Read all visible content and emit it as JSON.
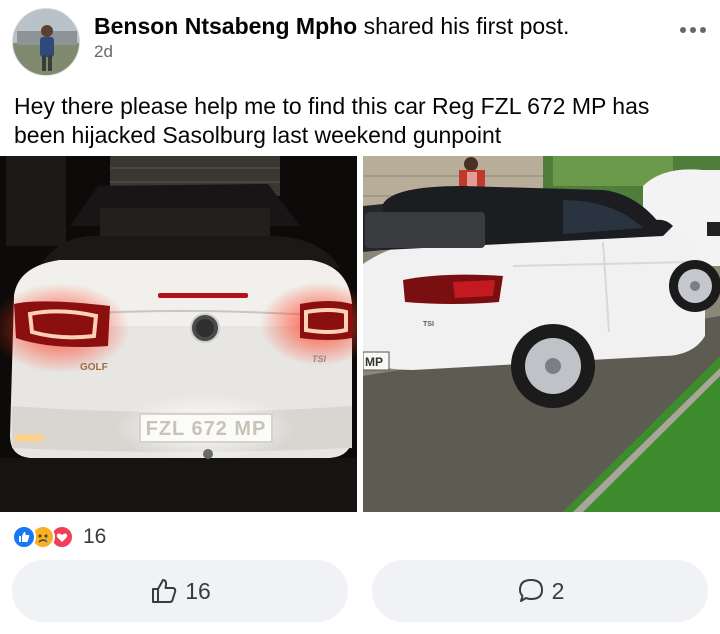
{
  "post": {
    "author": "Benson Ntsabeng Mpho",
    "action": "shared his first post.",
    "time": "2d",
    "text": "Hey there please help me to find this car Reg FZL 672 MP has been hijacked Sasolburg last weekend gunpoint"
  },
  "photos": [
    {
      "badge": "GOLF",
      "trim": "TSI",
      "plate": "FZL 672 MP"
    },
    {
      "trim": "TSI",
      "plate": "MP"
    }
  ],
  "reactions": {
    "icons": [
      "like-icon",
      "sad-icon",
      "love-icon"
    ],
    "count": "16"
  },
  "actions": {
    "like_count": "16",
    "comment_count": "2"
  },
  "icons": {
    "more": "more-horizontal-icon",
    "like": "thumbs-up-icon",
    "comment": "comment-bubble-icon"
  },
  "colors": {
    "like_blue": "#1877f2",
    "button_bg": "#f0f2f5",
    "secondary_text": "#65676b"
  }
}
